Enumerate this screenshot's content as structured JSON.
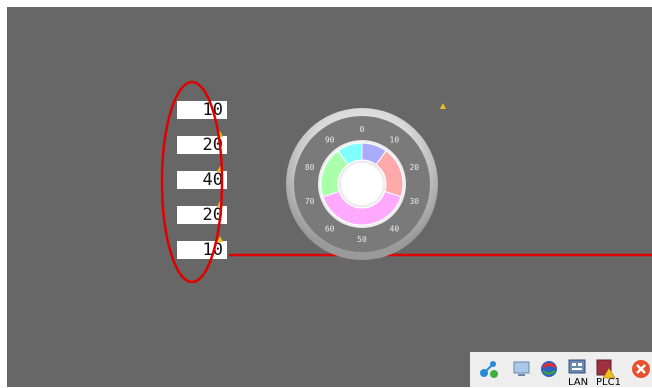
{
  "screen": {
    "background": "#676767",
    "values": [
      "10",
      "20",
      "40",
      "20",
      "10"
    ],
    "alarm_icon": "warning-icon"
  },
  "gauge": {
    "scale_labels": [
      "0",
      "10",
      "20",
      "30",
      "40",
      "50",
      "60",
      "70",
      "80",
      "90"
    ],
    "segments": [
      {
        "value": 10,
        "color": "#aaaaff"
      },
      {
        "value": 20,
        "color": "#ffaaaa"
      },
      {
        "value": 40,
        "color": "#ffaaff"
      },
      {
        "value": 20,
        "color": "#aaffaa"
      },
      {
        "value": 10,
        "color": "#80ffff"
      }
    ]
  },
  "annotation": {
    "color": "#e00000"
  },
  "taskbar": {
    "icons": [
      "network-diagnostic-icon",
      "monitor-icon",
      "browser-icon",
      "lan-icon",
      "plc-warning-icon",
      "close-icon"
    ],
    "lan_label": "LAN",
    "plc_label": "PLC1"
  }
}
